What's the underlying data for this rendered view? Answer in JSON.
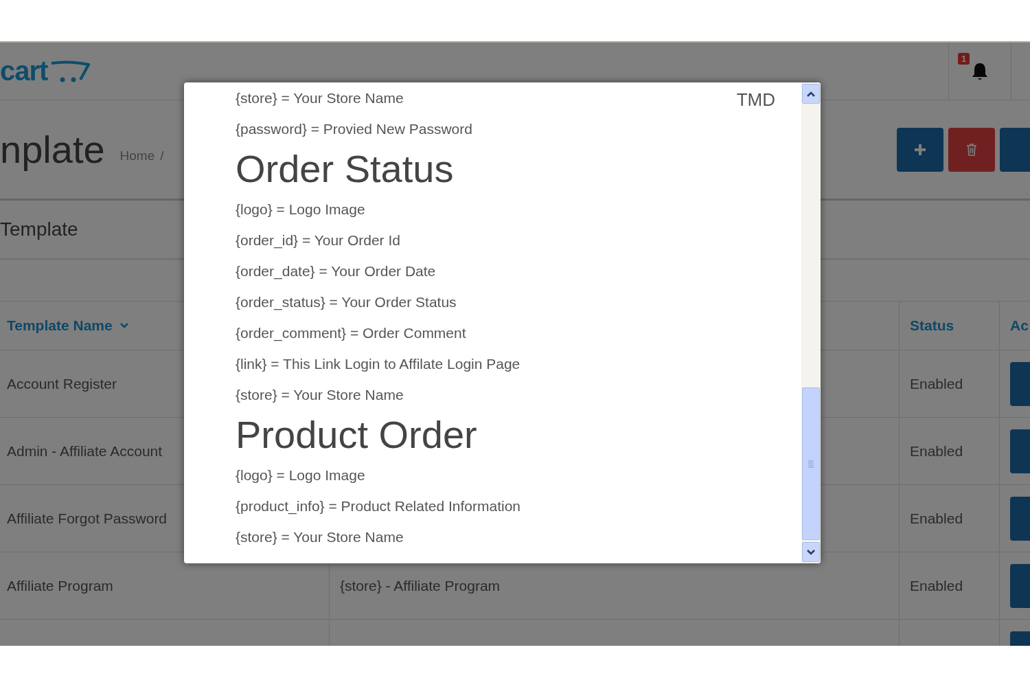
{
  "header": {
    "logo": "cart",
    "notification_count": "1"
  },
  "page_header": {
    "title": "nplate",
    "breadcrumb": [
      "Home",
      "/"
    ]
  },
  "panel": {
    "title": "Template"
  },
  "table": {
    "columns": [
      {
        "label": "Template Name",
        "sorted": true
      },
      {},
      {
        "label": "Status",
        "sorted": false
      },
      {
        "label": "Ac",
        "sorted": false
      }
    ],
    "rows": [
      {
        "name": "Account Register",
        "subject": "",
        "status": "Enabled"
      },
      {
        "name": "Admin - Affiliate Account",
        "subject": "",
        "status": "Enabled"
      },
      {
        "name": "Affiliate Forgot Password",
        "subject": "",
        "status": "Enabled"
      },
      {
        "name": "Affiliate Program",
        "subject": "{store} - Affiliate Program",
        "status": "Enabled"
      },
      {
        "name": "",
        "subject": "",
        "status": ""
      }
    ]
  },
  "modal": {
    "corner_label": "TMD",
    "content": [
      {
        "kind": "line",
        "text": "{store} = Your Store Name"
      },
      {
        "kind": "line",
        "text": "{password} = Provied New Password"
      },
      {
        "kind": "heading",
        "text": "Order Status"
      },
      {
        "kind": "line",
        "text": "{logo} = Logo Image"
      },
      {
        "kind": "line",
        "text": "{order_id} = Your Order Id"
      },
      {
        "kind": "line",
        "text": "{order_date} = Your Order Date"
      },
      {
        "kind": "line",
        "text": "{order_status} = Your Order Status"
      },
      {
        "kind": "line",
        "text": "{order_comment} = Order Comment"
      },
      {
        "kind": "line",
        "text": "{link} = This Link Login to Affilate Login Page"
      },
      {
        "kind": "line",
        "text": "{store} = Your Store Name"
      },
      {
        "kind": "heading",
        "text": "Product Order"
      },
      {
        "kind": "line",
        "text": "{logo} = Logo Image"
      },
      {
        "kind": "line",
        "text": "{product_info} = Product Related Information"
      },
      {
        "kind": "line",
        "text": "{store} = Your Store Name"
      }
    ]
  }
}
